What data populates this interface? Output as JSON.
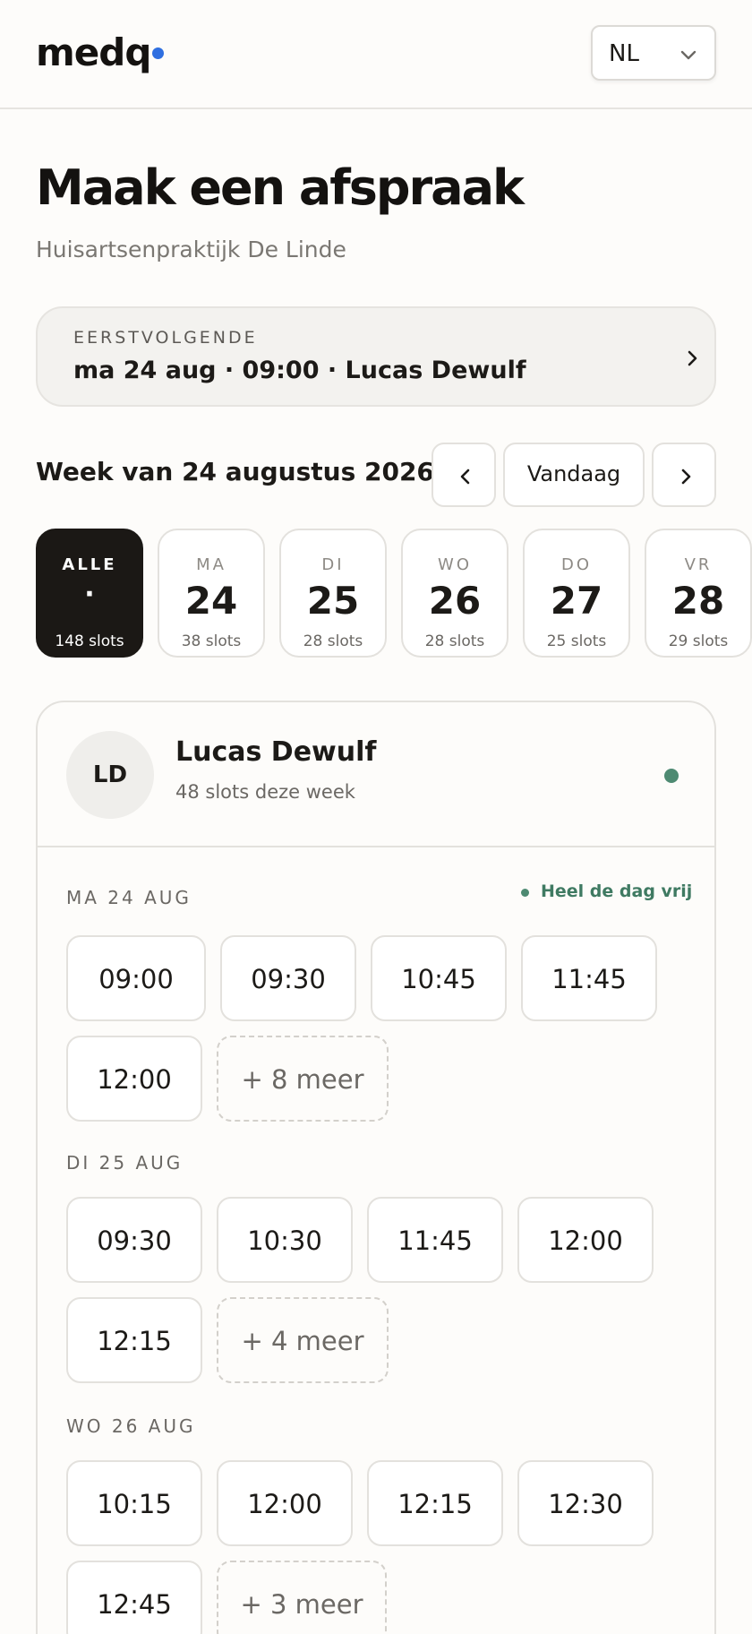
{
  "header": {
    "logo": "medq",
    "brand_dot_color": "#2f6fe0",
    "language": {
      "selected": "NL",
      "icon": "chevron-down-icon"
    }
  },
  "page": {
    "title": "Maak een afspraak",
    "subtitle": "Huisartsenpraktijk De Linde"
  },
  "next_available": {
    "kicker": "EERSTVOLGENDE",
    "value": "ma 24 aug · 09:00 · Lucas Dewulf",
    "icon": "chevron-right-icon"
  },
  "week_nav": {
    "title": "Week van 24 augustus 2026",
    "prev_icon": "chevron-left-icon",
    "today_label": "Vandaag",
    "next_icon": "chevron-right-icon"
  },
  "day_filter": [
    {
      "dow": "ALLE",
      "num": "·",
      "slots": "148 slots",
      "active": true
    },
    {
      "dow": "MA",
      "num": "24",
      "slots": "38 slots",
      "active": false
    },
    {
      "dow": "DI",
      "num": "25",
      "slots": "28 slots",
      "active": false
    },
    {
      "dow": "WO",
      "num": "26",
      "slots": "28 slots",
      "active": false
    },
    {
      "dow": "DO",
      "num": "27",
      "slots": "25 slots",
      "active": false
    },
    {
      "dow": "VR",
      "num": "28",
      "slots": "29 slots",
      "active": false
    }
  ],
  "doctor": {
    "initials": "LD",
    "name": "Lucas Dewulf",
    "meta": "48 slots deze week",
    "status_color": "#4e8a72",
    "days": [
      {
        "label": "MA 24 AUG",
        "badge": "Heel de dag vrij",
        "times": [
          "09:00",
          "09:30",
          "10:45",
          "11:45",
          "12:00"
        ],
        "more": "+ 8 meer"
      },
      {
        "label": "DI 25 AUG",
        "times": [
          "09:30",
          "10:30",
          "11:45",
          "12:00",
          "12:15"
        ],
        "more": "+ 4 meer"
      },
      {
        "label": "WO 26 AUG",
        "times": [
          "10:15",
          "12:00",
          "12:15",
          "12:30",
          "12:45"
        ],
        "more": "+ 3 meer"
      }
    ]
  }
}
